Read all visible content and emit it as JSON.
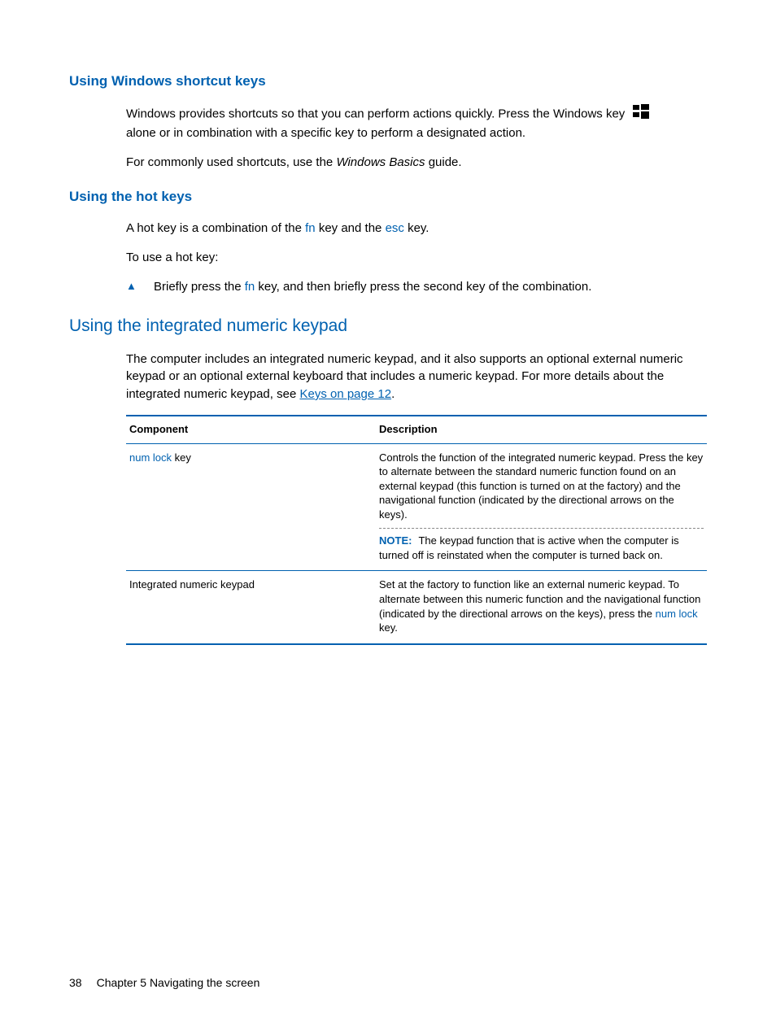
{
  "section1": {
    "heading": "Using Windows shortcut keys",
    "p1_a": "Windows provides shortcuts so that you can perform actions quickly. Press the Windows key",
    "p1_b": "alone or in combination with a specific key to perform a designated action.",
    "p2_a": "For commonly used shortcuts, use the ",
    "p2_italic": "Windows Basics",
    "p2_b": " guide."
  },
  "section2": {
    "heading": "Using the hot keys",
    "p1_a": "A hot key is a combination of the ",
    "fn": "fn",
    "p1_b": " key and the ",
    "esc": "esc",
    "p1_c": " key.",
    "p2": "To use a hot key:",
    "bullet_a": "Briefly press the ",
    "bullet_fn": "fn",
    "bullet_b": " key, and then briefly press the second key of the combination."
  },
  "section3": {
    "heading": "Using the integrated numeric keypad",
    "p_a": "The computer includes an integrated numeric keypad, and it also supports an optional external numeric keypad or an optional external keyboard that includes a numeric keypad. For more details about the integrated numeric keypad, see ",
    "link": "Keys on page 12",
    "p_b": "."
  },
  "table": {
    "col1": "Component",
    "col2": "Description",
    "rows": [
      {
        "comp_key": "num lock",
        "comp_suffix": " key",
        "desc": "Controls the function of the integrated numeric keypad. Press the key to alternate between the standard numeric function found on an external keypad (this function is turned on at the factory) and the navigational function (indicated by the directional arrows on the keys).",
        "note_label": "NOTE:",
        "note": "The keypad function that is active when the computer is turned off is reinstated when the computer is turned back on."
      },
      {
        "comp": "Integrated numeric keypad",
        "desc_a": "Set at the factory to function like an external numeric keypad. To alternate between this numeric function and the navigational function (indicated by the directional arrows on the keys), press the ",
        "desc_key": "num lock",
        "desc_b": " key."
      }
    ]
  },
  "footer": {
    "page": "38",
    "chapter": "Chapter 5   Navigating the screen"
  }
}
